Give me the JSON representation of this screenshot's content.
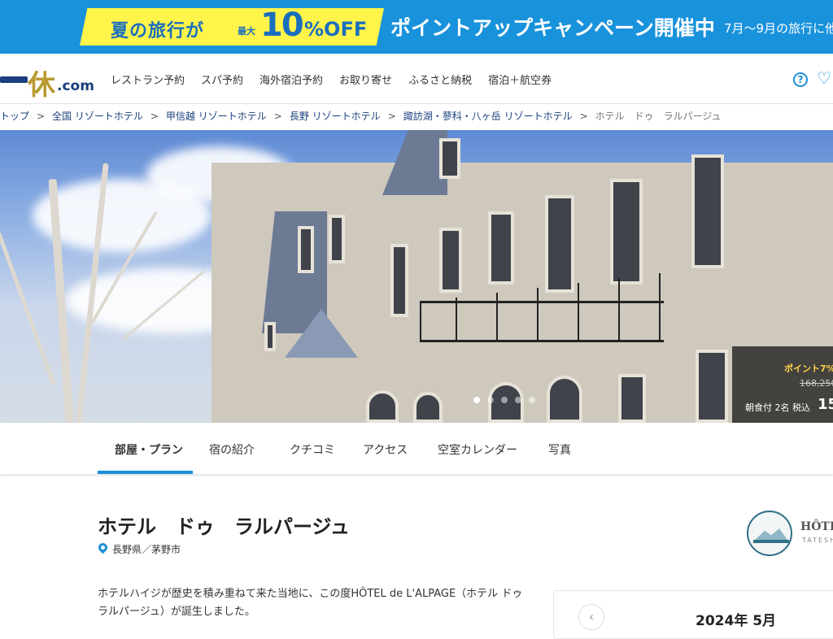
{
  "banner": {
    "summer_text": "夏の旅行が",
    "max_text": "最大",
    "percent_text": "10",
    "off_text": "%OFF",
    "campaign_text": "ポイントアップキャンペーン開催中",
    "period_text": "7月〜9月の旅行に他"
  },
  "header": {
    "logo_kyu": "休",
    "logo_com": ".com",
    "nav": [
      "レストラン予約",
      "スパ予約",
      "海外宿泊予約",
      "お取り寄せ",
      "ふるさと納税",
      "宿泊＋航空券"
    ],
    "help_icon": "?",
    "favorite_icon": "♡"
  },
  "breadcrumb": {
    "items": [
      "トップ",
      "全国 リゾートホテル",
      "甲信越 リゾートホテル",
      "長野 リゾートホテル",
      "諏訪湖・蓼科・八ヶ岳 リゾートホテル",
      "ホテル　ドゥ　ラルパージュ"
    ],
    "separator": ">"
  },
  "hero": {
    "point_text": "ポイント7%",
    "old_price": "168,250",
    "condition": "朝食付 2名 税込",
    "price_prefix": "15",
    "slides_total": 5,
    "slide_active": 1
  },
  "tabs": [
    "部屋・プラン",
    "宿の紹介",
    "クチコミ",
    "アクセス",
    "空室カレンダー",
    "写真"
  ],
  "hotel": {
    "name": "ホテル　ドゥ　ラルパージュ",
    "location": "長野県／茅野市",
    "logo_text": "HÔTE",
    "logo_sub": "TATESH",
    "description": "ホテルハイジが歴史を積み重ねて来た当地に、この度HÔTEL de L'ALPAGE（ホテル ドゥ ラルパージュ）が誕生しました。"
  },
  "calendar": {
    "prev_icon": "‹",
    "month": "2024年 5月"
  },
  "colors": {
    "banner_blue": "#1992dc",
    "banner_yellow": "#fff44a",
    "accent": "#1a8fd8",
    "link_navy": "#1a3f7c"
  }
}
